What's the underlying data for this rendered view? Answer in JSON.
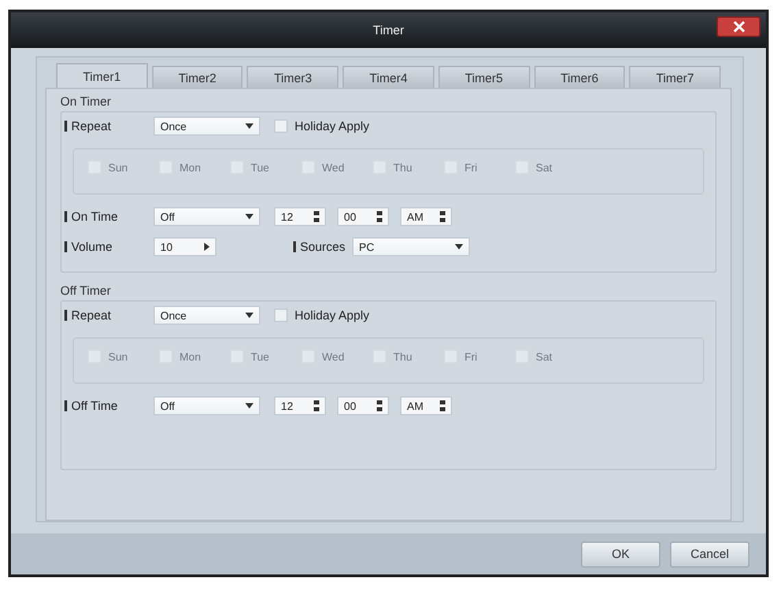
{
  "window": {
    "title": "Timer"
  },
  "tabs": [
    {
      "label": "Timer1",
      "selected": true
    },
    {
      "label": "Timer2",
      "selected": false
    },
    {
      "label": "Timer3",
      "selected": false
    },
    {
      "label": "Timer4",
      "selected": false
    },
    {
      "label": "Timer5",
      "selected": false
    },
    {
      "label": "Timer6",
      "selected": false
    },
    {
      "label": "Timer7",
      "selected": false
    }
  ],
  "sections": [
    {
      "title": "On Timer",
      "repeat_label": "Repeat",
      "repeat": "Once",
      "holiday": {
        "label": "Holiday Apply",
        "checked": false
      },
      "days": [
        {
          "label": "Sun",
          "checked": false,
          "disabled": true
        },
        {
          "label": "Mon",
          "checked": false,
          "disabled": true
        },
        {
          "label": "Tue",
          "checked": false,
          "disabled": true
        },
        {
          "label": "Wed",
          "checked": false,
          "disabled": true
        },
        {
          "label": "Thu",
          "checked": false,
          "disabled": true
        },
        {
          "label": "Fri",
          "checked": false,
          "disabled": true
        },
        {
          "label": "Sat",
          "checked": false,
          "disabled": true
        }
      ],
      "rows": [
        {
          "kind": "time",
          "label": "On Time",
          "mode": "Off",
          "hour": "12",
          "minute": "00",
          "ampm": "AM"
        },
        {
          "kind": "volume",
          "label": "Volume",
          "volume": "10",
          "source_label": "Sources",
          "source": "PC"
        }
      ]
    },
    {
      "title": "Off Timer",
      "repeat_label": "Repeat",
      "repeat": "Once",
      "holiday": {
        "label": "Holiday Apply",
        "checked": false
      },
      "days": [
        {
          "label": "Sun",
          "checked": false,
          "disabled": true
        },
        {
          "label": "Mon",
          "checked": false,
          "disabled": true
        },
        {
          "label": "Tue",
          "checked": false,
          "disabled": true
        },
        {
          "label": "Wed",
          "checked": false,
          "disabled": true
        },
        {
          "label": "Thu",
          "checked": false,
          "disabled": true
        },
        {
          "label": "Fri",
          "checked": false,
          "disabled": true
        },
        {
          "label": "Sat",
          "checked": false,
          "disabled": true
        }
      ],
      "rows": [
        {
          "kind": "time",
          "label": "Off Time",
          "mode": "Off",
          "hour": "12",
          "minute": "00",
          "ampm": "AM"
        }
      ]
    }
  ],
  "buttons": [
    {
      "label": "OK"
    },
    {
      "label": "Cancel"
    }
  ]
}
